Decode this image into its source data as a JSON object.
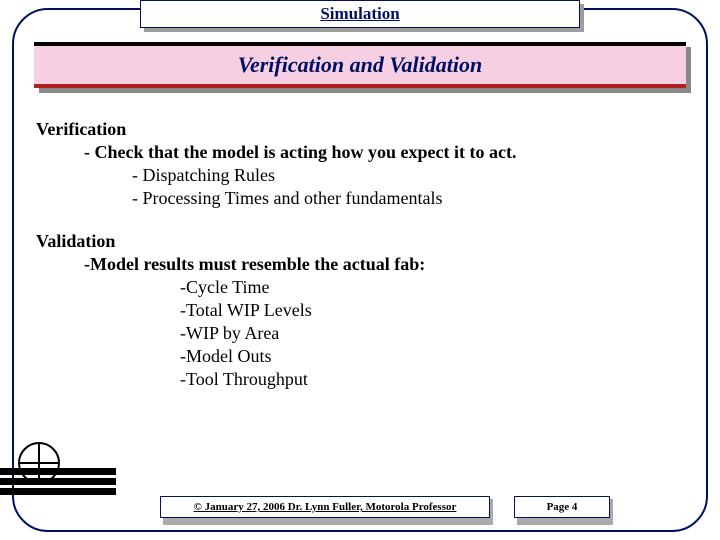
{
  "header": {
    "title": "Simulation"
  },
  "title_bar": {
    "text": "Verification and Validation"
  },
  "content": {
    "verification": {
      "heading": "Verification",
      "desc": "- Check that the model is acting how you expect it to act.",
      "items": [
        "- Dispatching Rules",
        "- Processing Times and other fundamentals"
      ]
    },
    "validation": {
      "heading": "Validation",
      "desc": "-Model results must resemble the actual fab:",
      "items": [
        "-Cycle Time",
        "-Total WIP Levels",
        "-WIP by Area",
        "-Model Outs",
        "-Tool Throughput"
      ]
    }
  },
  "footer": {
    "copyright": "© January 27, 2006  Dr. Lynn Fuller, Motorola Professor",
    "page": "Page 4"
  }
}
